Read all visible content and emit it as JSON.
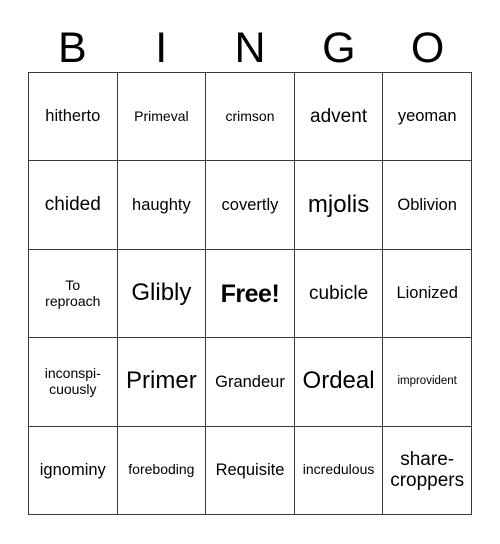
{
  "card": {
    "title": "BINGO",
    "header_letters": [
      "B",
      "I",
      "N",
      "G",
      "O"
    ],
    "free_space": "Free!",
    "grid": [
      [
        {
          "text": "hitherto",
          "size": "md"
        },
        {
          "text": "Primeval",
          "size": "sm"
        },
        {
          "text": "crimson",
          "size": "sm"
        },
        {
          "text": "advent",
          "size": "lg"
        },
        {
          "text": "yeoman",
          "size": "md"
        }
      ],
      [
        {
          "text": "chided",
          "size": "lg"
        },
        {
          "text": "haughty",
          "size": "md"
        },
        {
          "text": "covertly",
          "size": "md"
        },
        {
          "text": "mjolis",
          "size": "xl"
        },
        {
          "text": "Oblivion",
          "size": "md"
        }
      ],
      [
        {
          "text": "To reproach",
          "size": "sm"
        },
        {
          "text": "Glibly",
          "size": "xl"
        },
        {
          "text": "Free!",
          "size": "free"
        },
        {
          "text": "cubicle",
          "size": "lg"
        },
        {
          "text": "Lionized",
          "size": "md"
        }
      ],
      [
        {
          "text": "inconspi-cuously",
          "size": "sm"
        },
        {
          "text": "Primer",
          "size": "xl"
        },
        {
          "text": "Grandeur",
          "size": "md"
        },
        {
          "text": "Ordeal",
          "size": "xl"
        },
        {
          "text": "improvident",
          "size": "xs"
        }
      ],
      [
        {
          "text": "ignominy",
          "size": "md"
        },
        {
          "text": "foreboding",
          "size": "sm"
        },
        {
          "text": "Requisite",
          "size": "md"
        },
        {
          "text": "incredulous",
          "size": "sm"
        },
        {
          "text": "share-croppers",
          "size": "lg"
        }
      ]
    ],
    "colors": {
      "background": "#ffffff",
      "text": "#000000",
      "grid_line": "#3a3a3a"
    }
  }
}
